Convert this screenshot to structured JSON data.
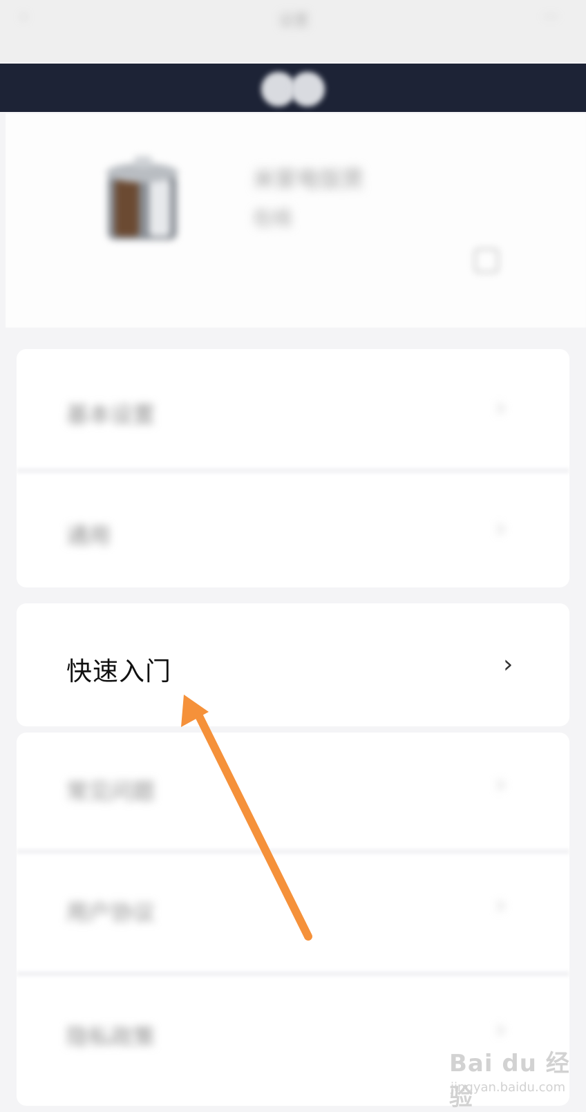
{
  "header": {
    "title": "设置",
    "back_icon": "back-arrow-icon",
    "more_icon": "more-icon"
  },
  "device": {
    "name": "米家电饭煲",
    "status": "在线",
    "image": "rice-cooker-image",
    "edit_icon": "edit-icon"
  },
  "menu": {
    "blurred_top": [
      "基本设置",
      "通用"
    ],
    "highlighted": {
      "label": "快速入门",
      "chevron": "›"
    },
    "blurred_bottom": [
      "常见问题",
      "用户协议",
      "隐私政策"
    ]
  },
  "annotation": {
    "arrow_color": "#f5913a",
    "arrow_icon": "pointer-arrow-icon"
  },
  "watermark": {
    "brand": "Bai du 经验",
    "sub": "jingyan.baidu.com"
  },
  "colors": {
    "background": "#f4f4f6",
    "dark_bar": "#1d2336",
    "arrow": "#f5913a"
  }
}
